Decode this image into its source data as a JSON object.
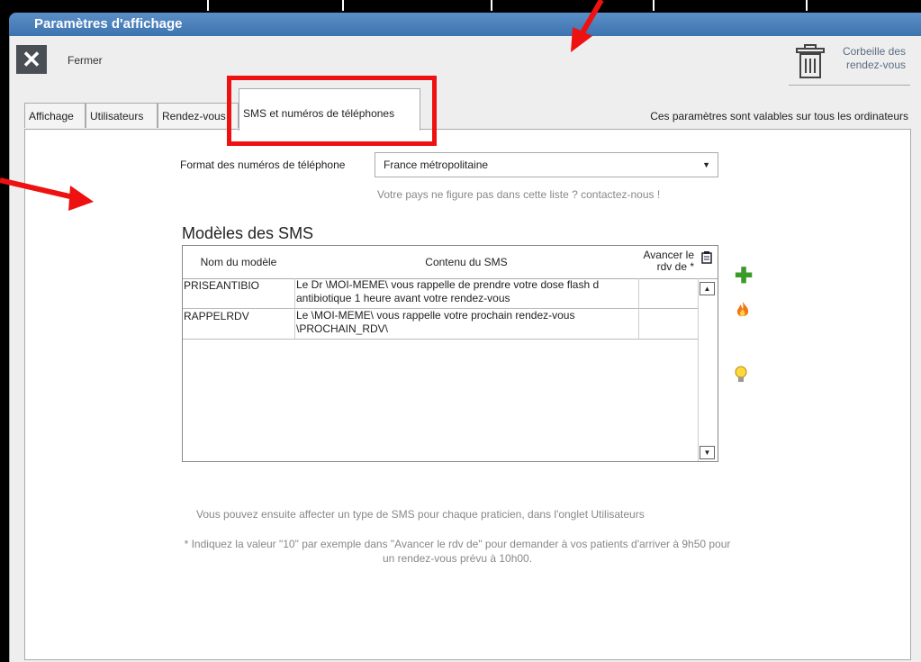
{
  "window": {
    "title": "Paramètres d'affichage"
  },
  "toolbar": {
    "close_label": "Fermer",
    "trash_label": "Corbeille des rendez-vous"
  },
  "tabs": [
    {
      "label": "Affichage"
    },
    {
      "label": "Utilisateurs"
    },
    {
      "label": "Rendez-vous"
    },
    {
      "label": "SMS et numéros de téléphones"
    }
  ],
  "tab_note": "Ces paramètres sont valables sur tous les ordinateurs",
  "phone": {
    "format_label": "Format des numéros de téléphone",
    "selected": "France métropolitaine",
    "contact_hint": "Votre pays ne figure pas dans cette liste ? contactez-nous !"
  },
  "sms": {
    "title": "Modèles des SMS",
    "columns": [
      "Nom du modèle",
      "Contenu du SMS",
      "Avancer le rdv de *"
    ],
    "rows": [
      {
        "name": "PRISEANTIBIO",
        "content": "Le Dr \\MOI-MEME\\ vous rappelle de prendre votre dose flash d antibiotique 1 heure avant votre rendez-vous",
        "advance": ""
      },
      {
        "name": "RAPPELRDV",
        "content": "Le \\MOI-MEME\\ vous rappelle votre prochain rendez-vous \\PROCHAIN_RDV\\",
        "advance": ""
      }
    ]
  },
  "footer": {
    "note1": "Vous pouvez ensuite affecter un type de SMS pour chaque praticien, dans l'onglet Utilisateurs",
    "note2": "* Indiquez la valeur \"10\" par exemple dans \"Avancer le rdv de\" pour demander à vos patients d'arriver à 9h50 pour un rendez-vous prévu à 10h00."
  },
  "colors": {
    "accent": "#e11111",
    "titlebar": "#4a80bd",
    "add": "#3a9a2a"
  },
  "icons": [
    "close-icon",
    "trash-icon",
    "clipboard-icon",
    "add-icon",
    "fire-icon",
    "lightbulb-icon",
    "chevron-down-icon",
    "scroll-up-icon",
    "scroll-down-icon",
    "red-arrow"
  ]
}
